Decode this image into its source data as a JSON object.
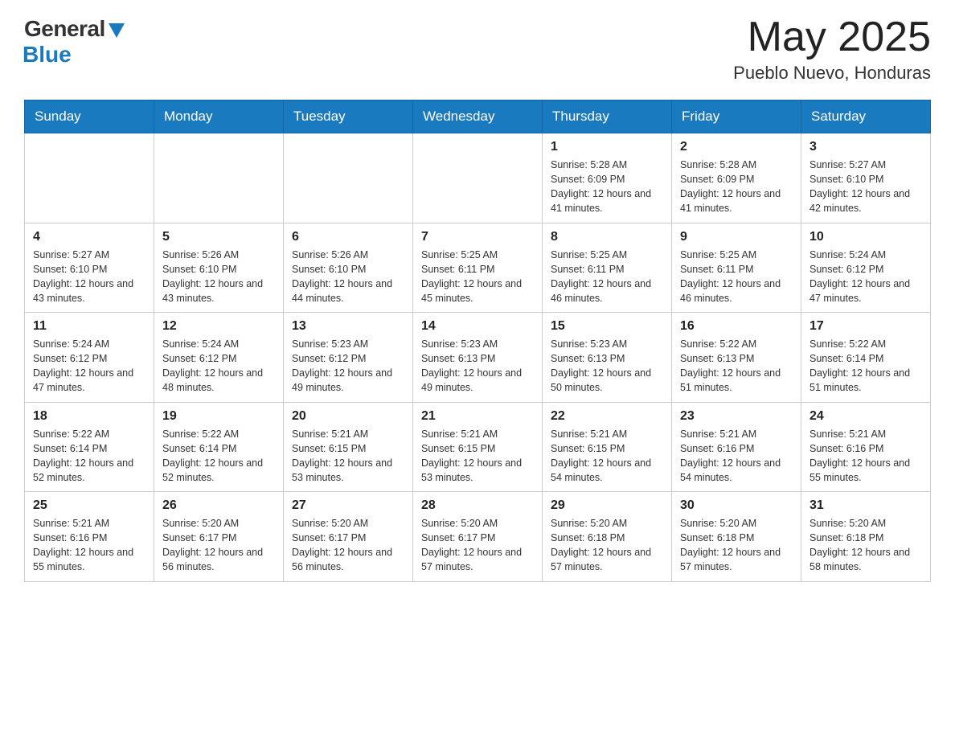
{
  "header": {
    "logo_general": "General",
    "logo_blue": "Blue",
    "month_title": "May 2025",
    "subtitle": "Pueblo Nuevo, Honduras"
  },
  "weekdays": [
    "Sunday",
    "Monday",
    "Tuesday",
    "Wednesday",
    "Thursday",
    "Friday",
    "Saturday"
  ],
  "weeks": [
    [
      {
        "day": "",
        "info": ""
      },
      {
        "day": "",
        "info": ""
      },
      {
        "day": "",
        "info": ""
      },
      {
        "day": "",
        "info": ""
      },
      {
        "day": "1",
        "info": "Sunrise: 5:28 AM\nSunset: 6:09 PM\nDaylight: 12 hours and 41 minutes."
      },
      {
        "day": "2",
        "info": "Sunrise: 5:28 AM\nSunset: 6:09 PM\nDaylight: 12 hours and 41 minutes."
      },
      {
        "day": "3",
        "info": "Sunrise: 5:27 AM\nSunset: 6:10 PM\nDaylight: 12 hours and 42 minutes."
      }
    ],
    [
      {
        "day": "4",
        "info": "Sunrise: 5:27 AM\nSunset: 6:10 PM\nDaylight: 12 hours and 43 minutes."
      },
      {
        "day": "5",
        "info": "Sunrise: 5:26 AM\nSunset: 6:10 PM\nDaylight: 12 hours and 43 minutes."
      },
      {
        "day": "6",
        "info": "Sunrise: 5:26 AM\nSunset: 6:10 PM\nDaylight: 12 hours and 44 minutes."
      },
      {
        "day": "7",
        "info": "Sunrise: 5:25 AM\nSunset: 6:11 PM\nDaylight: 12 hours and 45 minutes."
      },
      {
        "day": "8",
        "info": "Sunrise: 5:25 AM\nSunset: 6:11 PM\nDaylight: 12 hours and 46 minutes."
      },
      {
        "day": "9",
        "info": "Sunrise: 5:25 AM\nSunset: 6:11 PM\nDaylight: 12 hours and 46 minutes."
      },
      {
        "day": "10",
        "info": "Sunrise: 5:24 AM\nSunset: 6:12 PM\nDaylight: 12 hours and 47 minutes."
      }
    ],
    [
      {
        "day": "11",
        "info": "Sunrise: 5:24 AM\nSunset: 6:12 PM\nDaylight: 12 hours and 47 minutes."
      },
      {
        "day": "12",
        "info": "Sunrise: 5:24 AM\nSunset: 6:12 PM\nDaylight: 12 hours and 48 minutes."
      },
      {
        "day": "13",
        "info": "Sunrise: 5:23 AM\nSunset: 6:12 PM\nDaylight: 12 hours and 49 minutes."
      },
      {
        "day": "14",
        "info": "Sunrise: 5:23 AM\nSunset: 6:13 PM\nDaylight: 12 hours and 49 minutes."
      },
      {
        "day": "15",
        "info": "Sunrise: 5:23 AM\nSunset: 6:13 PM\nDaylight: 12 hours and 50 minutes."
      },
      {
        "day": "16",
        "info": "Sunrise: 5:22 AM\nSunset: 6:13 PM\nDaylight: 12 hours and 51 minutes."
      },
      {
        "day": "17",
        "info": "Sunrise: 5:22 AM\nSunset: 6:14 PM\nDaylight: 12 hours and 51 minutes."
      }
    ],
    [
      {
        "day": "18",
        "info": "Sunrise: 5:22 AM\nSunset: 6:14 PM\nDaylight: 12 hours and 52 minutes."
      },
      {
        "day": "19",
        "info": "Sunrise: 5:22 AM\nSunset: 6:14 PM\nDaylight: 12 hours and 52 minutes."
      },
      {
        "day": "20",
        "info": "Sunrise: 5:21 AM\nSunset: 6:15 PM\nDaylight: 12 hours and 53 minutes."
      },
      {
        "day": "21",
        "info": "Sunrise: 5:21 AM\nSunset: 6:15 PM\nDaylight: 12 hours and 53 minutes."
      },
      {
        "day": "22",
        "info": "Sunrise: 5:21 AM\nSunset: 6:15 PM\nDaylight: 12 hours and 54 minutes."
      },
      {
        "day": "23",
        "info": "Sunrise: 5:21 AM\nSunset: 6:16 PM\nDaylight: 12 hours and 54 minutes."
      },
      {
        "day": "24",
        "info": "Sunrise: 5:21 AM\nSunset: 6:16 PM\nDaylight: 12 hours and 55 minutes."
      }
    ],
    [
      {
        "day": "25",
        "info": "Sunrise: 5:21 AM\nSunset: 6:16 PM\nDaylight: 12 hours and 55 minutes."
      },
      {
        "day": "26",
        "info": "Sunrise: 5:20 AM\nSunset: 6:17 PM\nDaylight: 12 hours and 56 minutes."
      },
      {
        "day": "27",
        "info": "Sunrise: 5:20 AM\nSunset: 6:17 PM\nDaylight: 12 hours and 56 minutes."
      },
      {
        "day": "28",
        "info": "Sunrise: 5:20 AM\nSunset: 6:17 PM\nDaylight: 12 hours and 57 minutes."
      },
      {
        "day": "29",
        "info": "Sunrise: 5:20 AM\nSunset: 6:18 PM\nDaylight: 12 hours and 57 minutes."
      },
      {
        "day": "30",
        "info": "Sunrise: 5:20 AM\nSunset: 6:18 PM\nDaylight: 12 hours and 57 minutes."
      },
      {
        "day": "31",
        "info": "Sunrise: 5:20 AM\nSunset: 6:18 PM\nDaylight: 12 hours and 58 minutes."
      }
    ]
  ]
}
